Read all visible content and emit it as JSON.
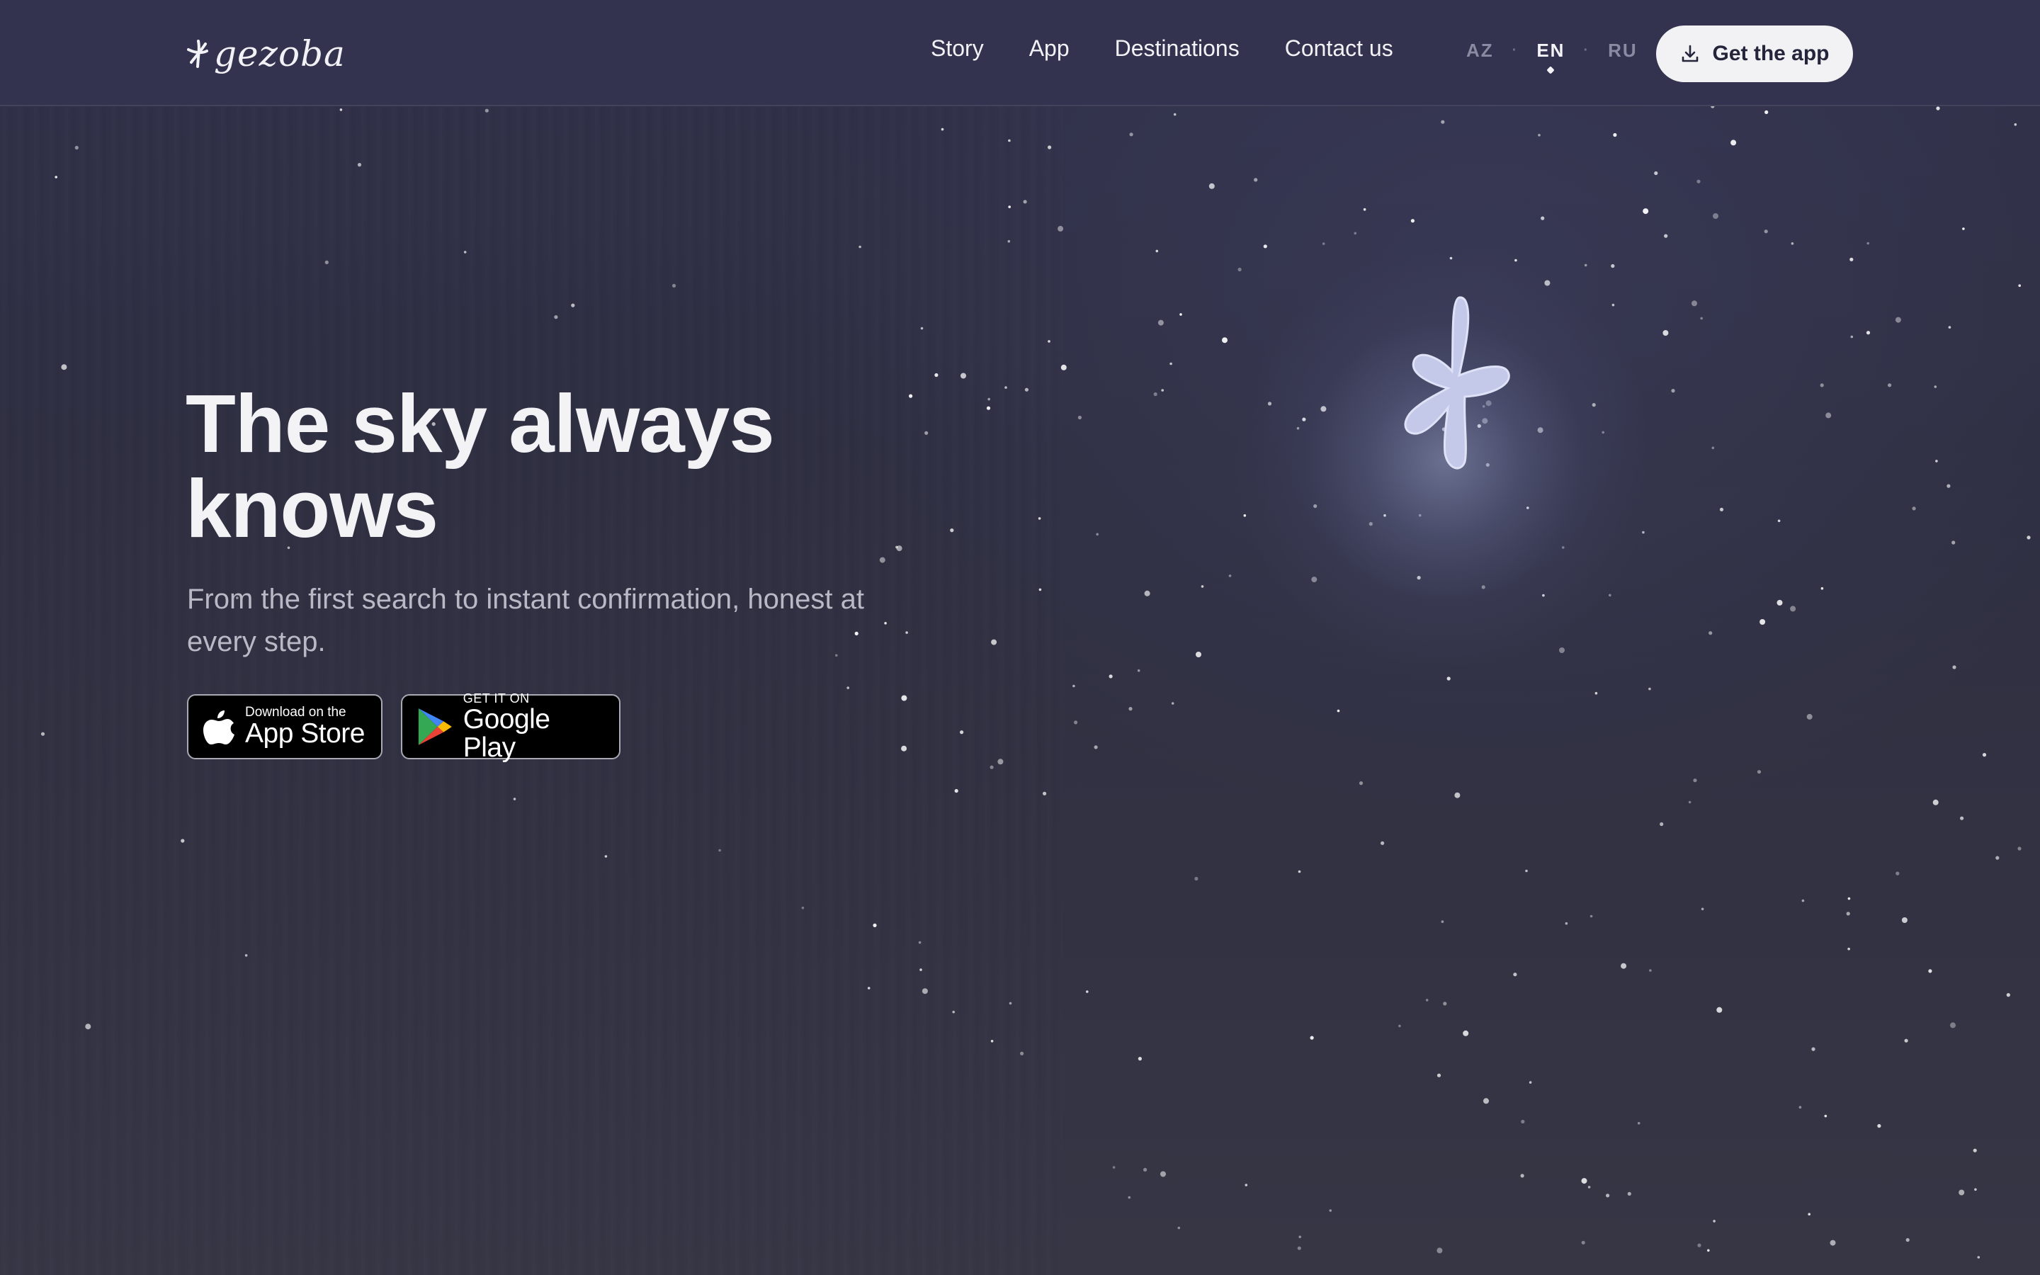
{
  "header": {
    "logo_text": "gezoba",
    "nav": [
      "Story",
      "App",
      "Destinations",
      "Contact us"
    ],
    "languages": [
      "AZ",
      "EN",
      "RU"
    ],
    "active_language": "EN",
    "cta_label": "Get the app",
    "cta_icon": "download-icon"
  },
  "hero": {
    "title": "The sky always knows",
    "subtitle": "From the first search to instant confirmation, honest at every step."
  },
  "stores": {
    "apple": {
      "small": "Download on the",
      "big": "App Store",
      "icon": "apple-icon"
    },
    "google": {
      "small": "GET IT ON",
      "big": "Google Play",
      "icon": "google-play-icon"
    }
  },
  "colors": {
    "background": "#2f2f42",
    "header": "#33334f",
    "text": "#f3f3f6",
    "muted": "#b9b9c6",
    "mascot": "#c4c9ea"
  }
}
